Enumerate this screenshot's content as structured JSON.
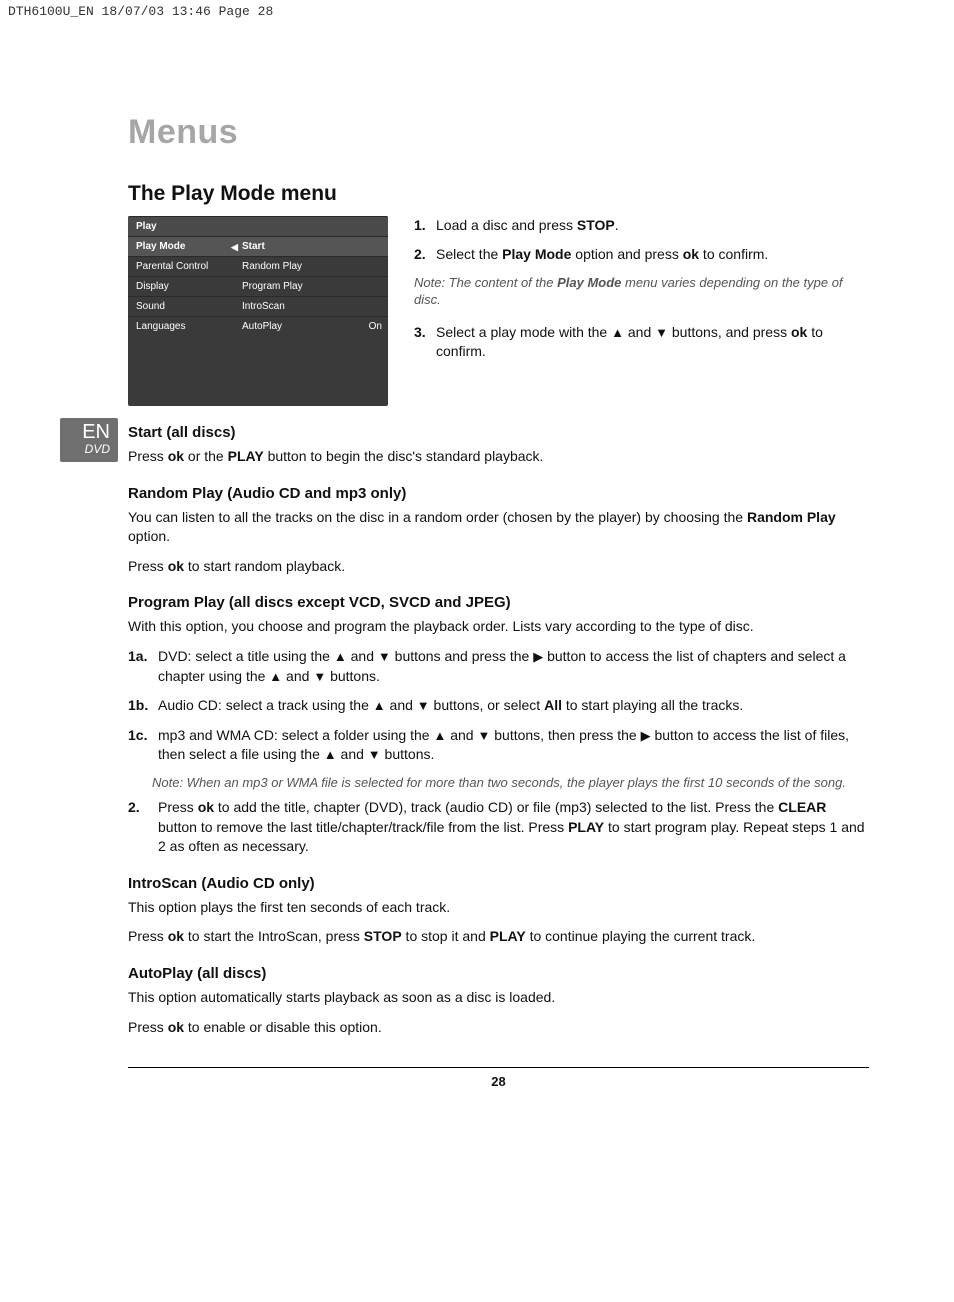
{
  "header": "DTH6100U_EN  18/07/03  13:46  Page 28",
  "title": "Menus",
  "section_title": "The Play Mode menu",
  "menu": {
    "header": "Play",
    "left": [
      "Play Mode",
      "Parental Control",
      "Display",
      "Sound",
      "Languages"
    ],
    "right": [
      "Start",
      "Random Play",
      "Program Play",
      "IntroScan",
      "AutoPlay"
    ],
    "autoplay_state": "On"
  },
  "glyphs": {
    "up": "▲",
    "down": "▼",
    "right": "▶",
    "left": "◀"
  },
  "steps": {
    "s1_num": "1.",
    "s1_a": "Load a disc and press ",
    "s1_b": "STOP",
    "s1_c": ".",
    "s2_num": "2.",
    "s2_a": "Select the ",
    "s2_b": "Play Mode",
    "s2_c": " option and press ",
    "s2_d": "ok",
    "s2_e": " to confirm.",
    "note_a": "Note: The content of the ",
    "note_b": "Play Mode",
    "note_c": " menu varies depending on the type of disc.",
    "s3_num": "3.",
    "s3_a": "Select a play mode with the ",
    "s3_b": " and ",
    "s3_c": " buttons, and press ",
    "s3_d": "ok",
    "s3_e": " to confirm."
  },
  "badge": {
    "en": "EN",
    "dvd": "DVD"
  },
  "start": {
    "h": "Start (all discs)",
    "p_a": "Press ",
    "p_b": "ok",
    "p_c": " or the ",
    "p_d": "PLAY",
    "p_e": " button to begin the disc's standard playback."
  },
  "random": {
    "h": "Random Play (Audio CD and mp3 only)",
    "p1_a": "You can listen to all the tracks on the disc in a random order (chosen by the player) by choosing the ",
    "p1_b": "Random Play",
    "p1_c": " option.",
    "p2_a": "Press ",
    "p2_b": "ok",
    "p2_c": " to start random playback."
  },
  "program": {
    "h": "Program Play (all discs except VCD, SVCD and JPEG)",
    "p1": "With this option, you choose and program the playback order. Lists vary according to the type of disc.",
    "l1a_lab": "1a.",
    "l1a_a": "DVD: select a title using the ",
    "l1a_b": " and ",
    "l1a_c": " buttons and press the ",
    "l1a_d": " button to access the list of chapters and select a chapter using the ",
    "l1a_e": " and ",
    "l1a_f": " buttons.",
    "l1b_lab": "1b.",
    "l1b_a": "Audio CD: select a track using the ",
    "l1b_b": " and ",
    "l1b_c": " buttons, or select ",
    "l1b_d": "All",
    "l1b_e": " to start playing all the tracks.",
    "l1c_lab": "1c.",
    "l1c_a": "mp3 and WMA CD: select a folder using the ",
    "l1c_b": " and ",
    "l1c_c": " buttons, then press the ",
    "l1c_d": " button to access the list of files, then select a file using the ",
    "l1c_e": " and ",
    "l1c_f": " buttons.",
    "note": "Note: When an mp3 or WMA file is selected for more than two seconds, the player plays the first 10 seconds of the song.",
    "l2_lab": "2.",
    "l2_a": "Press ",
    "l2_b": "ok",
    "l2_c": " to add the title, chapter (DVD), track (audio CD) or file (mp3) selected to the list. Press the ",
    "l2_d": "CLEAR",
    "l2_e": " button to remove the last title/chapter/track/file from the list. Press ",
    "l2_f": "PLAY",
    "l2_g": " to start program play. Repeat steps 1 and 2 as often as necessary."
  },
  "introscan": {
    "h": "IntroScan (Audio CD only)",
    "p1": "This option plays the first ten seconds of each track.",
    "p2_a": "Press ",
    "p2_b": "ok",
    "p2_c": " to start the IntroScan, press ",
    "p2_d": "STOP",
    "p2_e": " to stop it and ",
    "p2_f": "PLAY",
    "p2_g": " to continue playing the current track."
  },
  "autoplay": {
    "h": "AutoPlay (all discs)",
    "p1": "This option automatically starts playback as soon as a disc is loaded.",
    "p2_a": "Press ",
    "p2_b": "ok",
    "p2_c": " to enable or disable this option."
  },
  "page_number": "28"
}
